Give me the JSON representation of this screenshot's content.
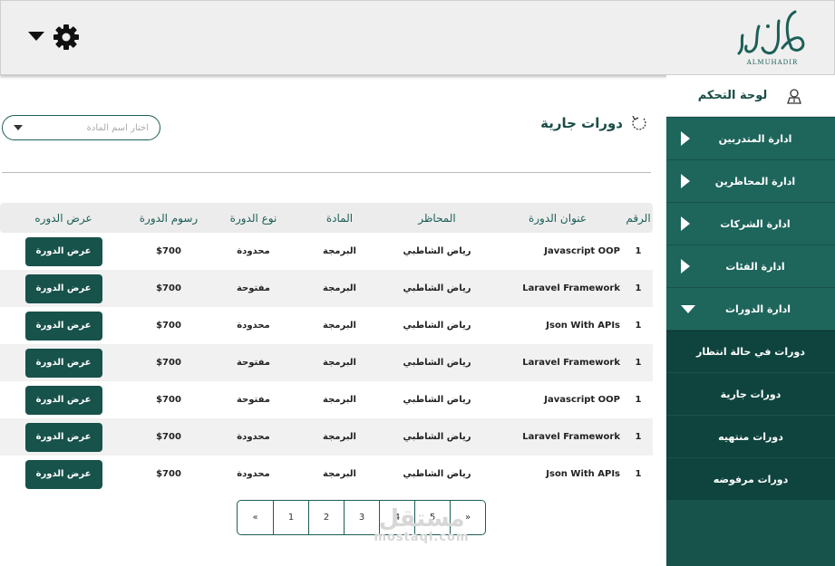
{
  "header": {
    "logo_text": "ALMUHADIR",
    "gear_icon": "gear-icon",
    "caret_icon": "caret-down-icon"
  },
  "sidebar": {
    "title": "لوحة التحكم",
    "title_icon": "user-badge-icon",
    "items": [
      {
        "label": "ادارة المتدربين"
      },
      {
        "label": "ادارة المحاظرين"
      },
      {
        "label": "ادارة الشركات"
      },
      {
        "label": "ادارة الفئات"
      },
      {
        "label": "ادارة الدورات"
      }
    ],
    "subitems": [
      {
        "label": "دورات في حالة انتظار"
      },
      {
        "label": "دورات جارية"
      },
      {
        "label": "دورات منتهيه"
      },
      {
        "label": "دورات مرفوضه"
      }
    ]
  },
  "main": {
    "title": "دورات جارية",
    "select_placeholder": "اختار اسم المادة"
  },
  "table": {
    "headers": [
      "الرقم",
      "عنوان الدورة",
      "المحاظر",
      "المادة",
      "نوع الدورة",
      "رسوم الدورة",
      "عرض الدوره"
    ],
    "rows": [
      {
        "num": "1",
        "title": "Javascript OOP",
        "lecturer": "رياض الشاطبي",
        "subject": "البرمجة",
        "type": "محدودة",
        "fee": "$700",
        "action": "عرض الدورة"
      },
      {
        "num": "1",
        "title": "Laravel Framework",
        "lecturer": "رياض الشاطبي",
        "subject": "البرمجة",
        "type": "مفتوحة",
        "fee": "$700",
        "action": "عرض الدورة"
      },
      {
        "num": "1",
        "title": "Json With APIs",
        "lecturer": "رياض الشاطبي",
        "subject": "البرمجة",
        "type": "محدودة",
        "fee": "$700",
        "action": "عرض الدورة"
      },
      {
        "num": "1",
        "title": "Laravel Framework",
        "lecturer": "رياض الشاطبي",
        "subject": "البرمجة",
        "type": "مفتوحة",
        "fee": "$700",
        "action": "عرض الدورة"
      },
      {
        "num": "1",
        "title": "Javascript OOP",
        "lecturer": "رياض الشاطبي",
        "subject": "البرمجة",
        "type": "مفتوحة",
        "fee": "$700",
        "action": "عرض الدورة"
      },
      {
        "num": "1",
        "title": "Laravel Framework",
        "lecturer": "رياض الشاطبي",
        "subject": "البرمجة",
        "type": "محدودة",
        "fee": "$700",
        "action": "عرض الدورة"
      },
      {
        "num": "1",
        "title": "Json With APIs",
        "lecturer": "رياض الشاطبي",
        "subject": "البرمجة",
        "type": "محدودة",
        "fee": "$700",
        "action": "عرض الدورة"
      }
    ]
  },
  "pagination": {
    "first": "«",
    "pages": [
      "1",
      "2",
      "3",
      "4",
      "5"
    ],
    "last": "»"
  },
  "watermark": {
    "arabic": "مستقل",
    "latin": "mostaql.com"
  },
  "colors": {
    "primary": "#17524b",
    "sidebar_item": "#1e655c",
    "sidebar_sub": "#0f443e"
  }
}
